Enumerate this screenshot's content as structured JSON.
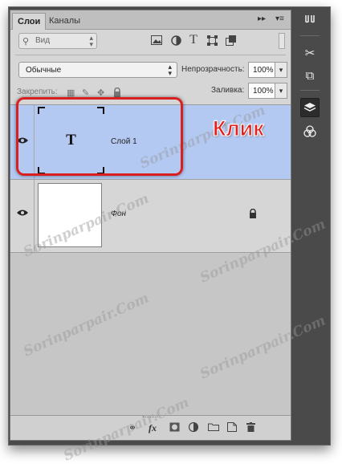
{
  "tabs": [
    {
      "label": "Слои",
      "active": true
    },
    {
      "label": "Каналы",
      "active": false
    }
  ],
  "tab_controls": {
    "collapse": "▸▸",
    "menu": "▾≡"
  },
  "filter": {
    "placeholder": "Вид",
    "icon": "search-icon"
  },
  "filter_icons": [
    "image-filter-icon",
    "adjustment-filter-icon",
    "text-filter-icon",
    "shape-filter-icon",
    "smart-object-filter-icon"
  ],
  "blend_mode": {
    "value": "Обычные"
  },
  "opacity": {
    "label": "Непрозрачность:",
    "value": "100%"
  },
  "lock": {
    "label": "Закрепить:",
    "icons": [
      "lock-transparent-icon",
      "lock-image-icon",
      "lock-position-icon",
      "lock-all-icon"
    ]
  },
  "fill": {
    "label": "Заливка:",
    "value": "100%"
  },
  "layers": [
    {
      "name": "Слой 1",
      "type": "text",
      "thumb_glyph": "T",
      "selected": true,
      "visible": true
    },
    {
      "name": "Фон",
      "type": "background",
      "selected": false,
      "visible": true,
      "locked": true
    }
  ],
  "annotation": {
    "text": "Клик",
    "color": "#e61e1e"
  },
  "watermark_text": "Sorinparpair.Com",
  "bottom_icons": [
    "link-layers-icon",
    "fx-icon",
    "mask-icon",
    "adjustment-layer-icon",
    "group-folder-icon",
    "new-layer-icon",
    "trash-icon"
  ],
  "colors": {
    "selection": "#b3c9f2",
    "panel": "#d6d6d6",
    "highlight": "#d91f1f"
  }
}
